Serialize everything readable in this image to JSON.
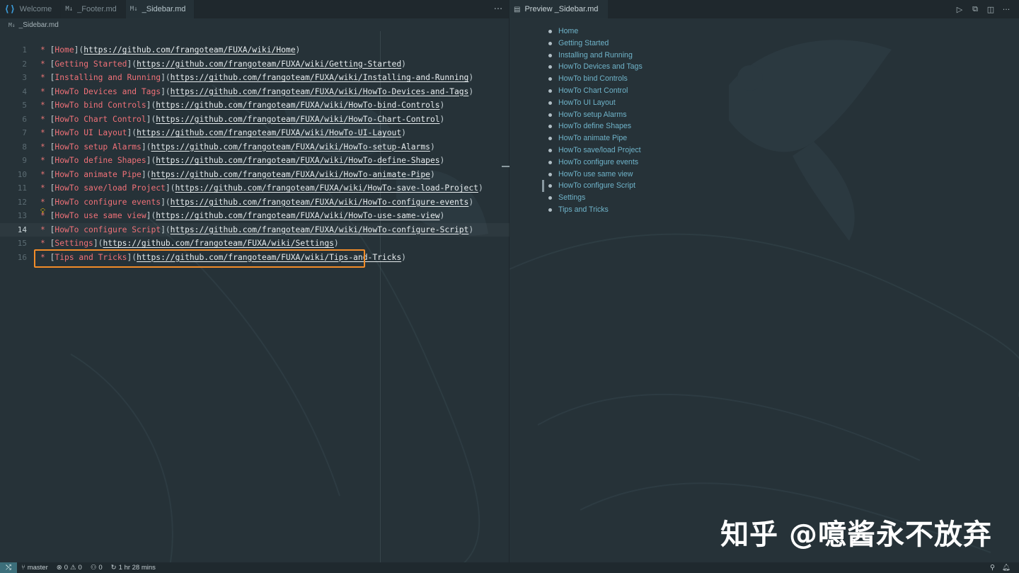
{
  "tabs": [
    {
      "label": "Welcome",
      "icon": "vscode-logo-icon",
      "active": false
    },
    {
      "label": "_Footer.md",
      "icon": "markdown-file-icon",
      "active": false
    },
    {
      "label": "_Sidebar.md",
      "icon": "markdown-file-icon",
      "active": true
    }
  ],
  "editor": {
    "more_label": "···",
    "breadcrumb": "_Sidebar.md",
    "current_line": 14,
    "highlighted_line": 16,
    "lines": [
      {
        "num": "1",
        "text": "Home",
        "url": "https://github.com/frangoteam/FUXA/wiki/Home"
      },
      {
        "num": "2",
        "text": "Getting Started",
        "url": "https://github.com/frangoteam/FUXA/wiki/Getting-Started"
      },
      {
        "num": "3",
        "text": "Installing and Running",
        "url": "https://github.com/frangoteam/FUXA/wiki/Installing-and-Running"
      },
      {
        "num": "4",
        "text": "HowTo Devices and Tags",
        "url": "https://github.com/frangoteam/FUXA/wiki/HowTo-Devices-and-Tags"
      },
      {
        "num": "5",
        "text": "HowTo bind Controls",
        "url": "https://github.com/frangoteam/FUXA/wiki/HowTo-bind-Controls"
      },
      {
        "num": "6",
        "text": "HowTo Chart Control",
        "url": "https://github.com/frangoteam/FUXA/wiki/HowTo-Chart-Control"
      },
      {
        "num": "7",
        "text": "HowTo UI Layout",
        "url": "https://github.com/frangoteam/FUXA/wiki/HowTo-UI-Layout"
      },
      {
        "num": "8",
        "text": "HowTo setup Alarms",
        "url": "https://github.com/frangoteam/FUXA/wiki/HowTo-setup-Alarms"
      },
      {
        "num": "9",
        "text": "HowTo define Shapes",
        "url": "https://github.com/frangoteam/FUXA/wiki/HowTo-define-Shapes"
      },
      {
        "num": "10",
        "text": "HowTo animate Pipe",
        "url": "https://github.com/frangoteam/FUXA/wiki/HowTo-animate-Pipe"
      },
      {
        "num": "11",
        "text": "HowTo save/load Project",
        "url": "https://github.com/frangoteam/FUXA/wiki/HowTo-save-load-Project"
      },
      {
        "num": "12",
        "text": "HowTo configure events",
        "url": "https://github.com/frangoteam/FUXA/wiki/HowTo-configure-events"
      },
      {
        "num": "13",
        "text": "HowTo use same view",
        "url": "https://github.com/frangoteam/FUXA/wiki/HowTo-use-same-view"
      },
      {
        "num": "14",
        "text": "HowTo configure Script",
        "url": "https://github.com/frangoteam/FUXA/wiki/HowTo-configure-Script"
      },
      {
        "num": "15",
        "text": "Settings",
        "url": "https://github.com/frangoteam/FUXA/wiki/Settings"
      },
      {
        "num": "16",
        "text": "Tips and Tricks",
        "url": "https://github.com/frangoteam/FUXA/wiki/Tips-and-Tricks"
      }
    ]
  },
  "preview": {
    "tab_label": "Preview _Sidebar.md",
    "tab_icon": "preview-icon",
    "items": [
      "Home",
      "Getting Started",
      "Installing and Running",
      "HowTo Devices and Tags",
      "HowTo bind Controls",
      "HowTo Chart Control",
      "HowTo UI Layout",
      "HowTo setup Alarms",
      "HowTo define Shapes",
      "HowTo animate Pipe",
      "HowTo save/load Project",
      "HowTo configure events",
      "HowTo use same view",
      "HowTo configure Script",
      "Settings",
      "Tips and Tricks"
    ]
  },
  "statusbar": {
    "branch": "master",
    "errors": "0",
    "warnings": "0",
    "ports": "0",
    "time": "1 hr 28 mins"
  },
  "watermark": "知乎 @噫酱永不放弃",
  "colors": {
    "background": "#263238",
    "link_text": "#f07178",
    "bullet": "#e57373",
    "preview_link": "#6fb3c9",
    "highlight_box": "#f28c28"
  }
}
